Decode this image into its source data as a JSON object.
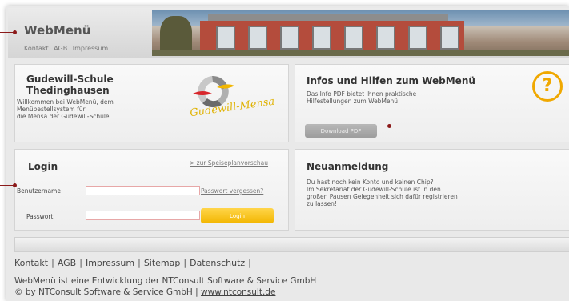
{
  "header": {
    "brand": "WebMenü",
    "links": [
      "Kontakt",
      "AGB",
      "Impressum"
    ]
  },
  "school": {
    "title_line1": "Gudewill-Schule",
    "title_line2": "Thedinghausen",
    "text_line1": "Willkommen bei WebMenü, dem",
    "text_line2": "Menübestellsystem für",
    "text_line3": "die Mensa der Gudewill-Schule.",
    "logo_text": "Gudewill-Mensa"
  },
  "info": {
    "title": "Infos und Hilfen zum WebMenü",
    "text_line1": "Das Info PDF bietet Ihnen praktische",
    "text_line2": "Hilfestellungen zum WebMenü",
    "icon": "?",
    "download_label": "Download PDF"
  },
  "login": {
    "title": "Login",
    "preview_link": "> zur Speiseplanvorschau",
    "username_label": "Benutzername",
    "forgot_link": "Passwort vergessen?",
    "password_label": "Passwort",
    "login_button": "Login"
  },
  "register": {
    "title": "Neuanmeldung",
    "text_line1": "Du hast noch kein Konto und keinen Chip?",
    "text_line2": "Im Sekretariat der Gudewill-Schule ist in den",
    "text_line3": "großen Pausen Gelegenheit sich dafür registrieren",
    "text_line4": "zu lassen!"
  },
  "footer": {
    "links": [
      "Kontakt",
      "AGB",
      "Impressum",
      "Sitemap",
      "Datenschutz"
    ],
    "line1": "WebMenü ist eine Entwicklung der NTConsult Software & Service GmbH",
    "line2_prefix": "© by NTConsult Software & Service GmbH | ",
    "site": "www.ntconsult.de"
  },
  "colors": {
    "accent_yellow": "#f2b600",
    "pointer": "#8b1a1a",
    "button_gray": "#a8a8a8"
  }
}
